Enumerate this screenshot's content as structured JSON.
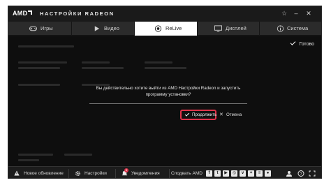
{
  "app": {
    "brand": "AMD",
    "title": "НАСТРОЙКИ RADEON"
  },
  "window_controls": {
    "favorite_icon": "star-icon",
    "minimize_icon": "minimize-icon",
    "close_icon": "close-icon"
  },
  "tabs": [
    {
      "label": "Игры",
      "icon": "gamepad-icon",
      "active": false
    },
    {
      "label": "Видео",
      "icon": "play-icon",
      "active": false
    },
    {
      "label": "ReLive",
      "icon": "record-icon",
      "active": true
    },
    {
      "label": "Дисплей",
      "icon": "monitor-icon",
      "active": false
    },
    {
      "label": "Система",
      "icon": "info-icon",
      "active": false
    }
  ],
  "main": {
    "done_label": "Готово"
  },
  "dialog": {
    "message": "Вы действительно хотите выйти из AMD Настройки Radeon и запустить программу установки?",
    "continue_label": "Продолжить",
    "cancel_label": "Отмена"
  },
  "bottombar": {
    "update_label": "Новое обновление",
    "settings_label": "Настройки",
    "notifications_label": "Уведомления",
    "notifications_count": "1",
    "share_label": "Сподвать AMD",
    "social_icons": [
      "facebook-icon",
      "twitter-icon",
      "youtube-icon",
      "instagram-icon",
      "vk-icon",
      "twitch-icon",
      "forum-icon",
      "community-icon"
    ]
  },
  "colors": {
    "accent_red": "#e0344b",
    "background": "#151515",
    "active_tab": "#ffffff"
  }
}
